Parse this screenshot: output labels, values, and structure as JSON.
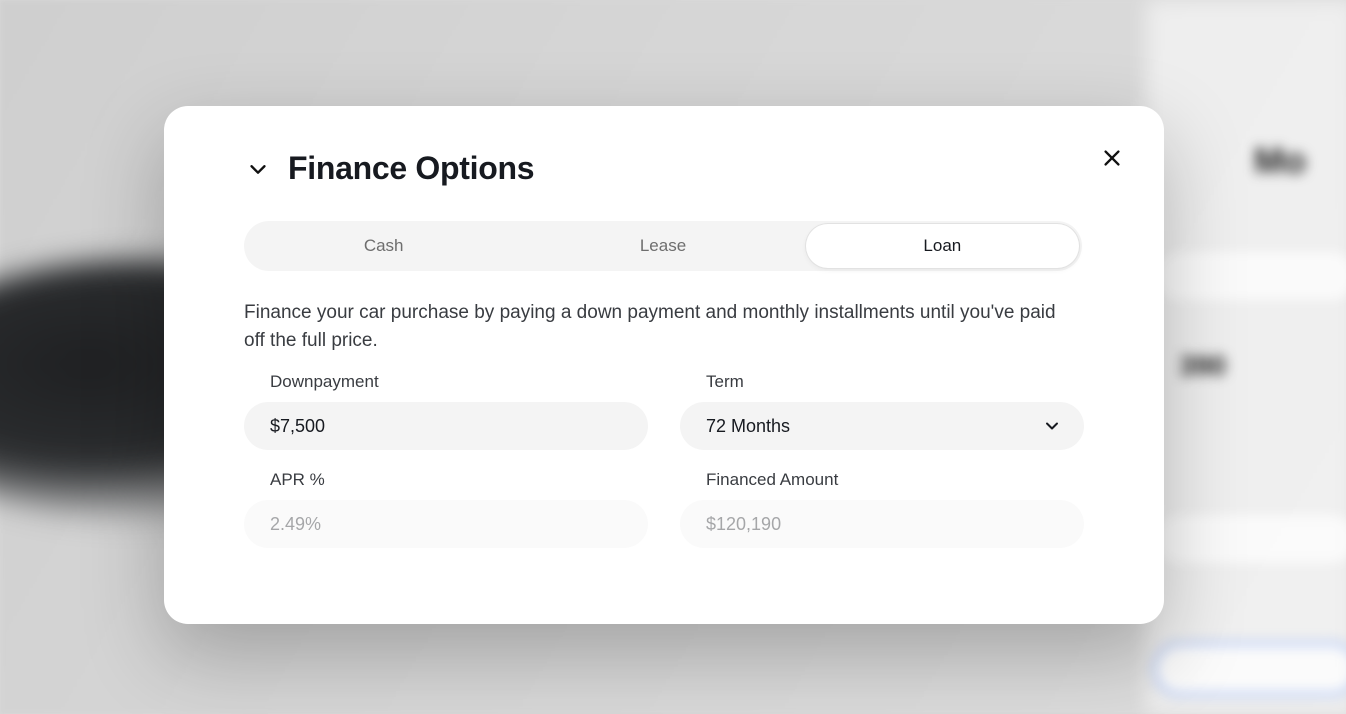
{
  "modal": {
    "title": "Finance Options",
    "tabs": {
      "cash": "Cash",
      "lease": "Lease",
      "loan": "Loan"
    },
    "active_tab": "loan",
    "description": "Finance your car purchase by paying a down payment and monthly installments until you've paid off the full price.",
    "fields": {
      "downpayment": {
        "label": "Downpayment",
        "value": "$7,500"
      },
      "term": {
        "label": "Term",
        "value": "72 Months"
      },
      "apr": {
        "label": "APR %",
        "value": "2.49%"
      },
      "financed": {
        "label": "Financed Amount",
        "value": "$120,190"
      }
    }
  },
  "background": {
    "title_hint": "Mo",
    "stat_hint": "390"
  }
}
